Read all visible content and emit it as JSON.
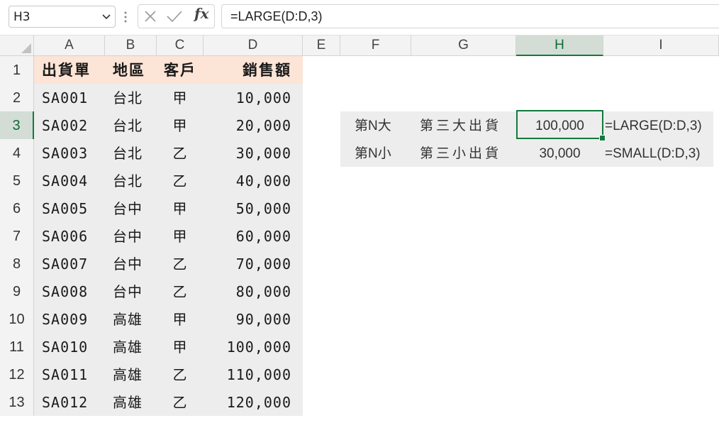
{
  "name_box": {
    "value": "H3"
  },
  "formula_bar": {
    "value": "=LARGE(D:D,3)",
    "fx_label": "fx"
  },
  "columns": [
    "A",
    "B",
    "C",
    "D",
    "E",
    "F",
    "G",
    "H",
    "I"
  ],
  "rows": [
    "1",
    "2",
    "3",
    "4",
    "5",
    "6",
    "7",
    "8",
    "9",
    "10",
    "11",
    "12",
    "13"
  ],
  "selected_column": "H",
  "selected_row": "3",
  "table": {
    "headers": [
      "出貨單",
      "地區",
      "客戶",
      "銷售額"
    ],
    "records": [
      [
        "SA001",
        "台北",
        "甲",
        "10,000"
      ],
      [
        "SA002",
        "台北",
        "甲",
        "20,000"
      ],
      [
        "SA003",
        "台北",
        "乙",
        "30,000"
      ],
      [
        "SA004",
        "台北",
        "乙",
        "40,000"
      ],
      [
        "SA005",
        "台中",
        "甲",
        "50,000"
      ],
      [
        "SA006",
        "台中",
        "甲",
        "60,000"
      ],
      [
        "SA007",
        "台中",
        "乙",
        "70,000"
      ],
      [
        "SA008",
        "台中",
        "乙",
        "80,000"
      ],
      [
        "SA009",
        "高雄",
        "甲",
        "90,000"
      ],
      [
        "SA010",
        "高雄",
        "甲",
        "100,000"
      ],
      [
        "SA011",
        "高雄",
        "乙",
        "110,000"
      ],
      [
        "SA012",
        "高雄",
        "乙",
        "120,000"
      ]
    ]
  },
  "summary": [
    {
      "f": "第N大",
      "g": "第三大出貨",
      "h": "100,000",
      "i": "=LARGE(D:D,3)"
    },
    {
      "f": "第N小",
      "g": "第三小出貨",
      "h": "30,000",
      "i": "=SMALL(D:D,3)"
    }
  ],
  "colors": {
    "header_fill": "#fce4d6",
    "table_fill": "#ededed",
    "selection_green": "#137a3e"
  },
  "icons": {
    "name_box_dropdown": "chevron-down-icon",
    "cancel": "close-icon",
    "enter": "check-icon",
    "insert_function": "fx-icon",
    "options": "more-vertical-icon",
    "select_all": "select-all-triangle-icon"
  }
}
